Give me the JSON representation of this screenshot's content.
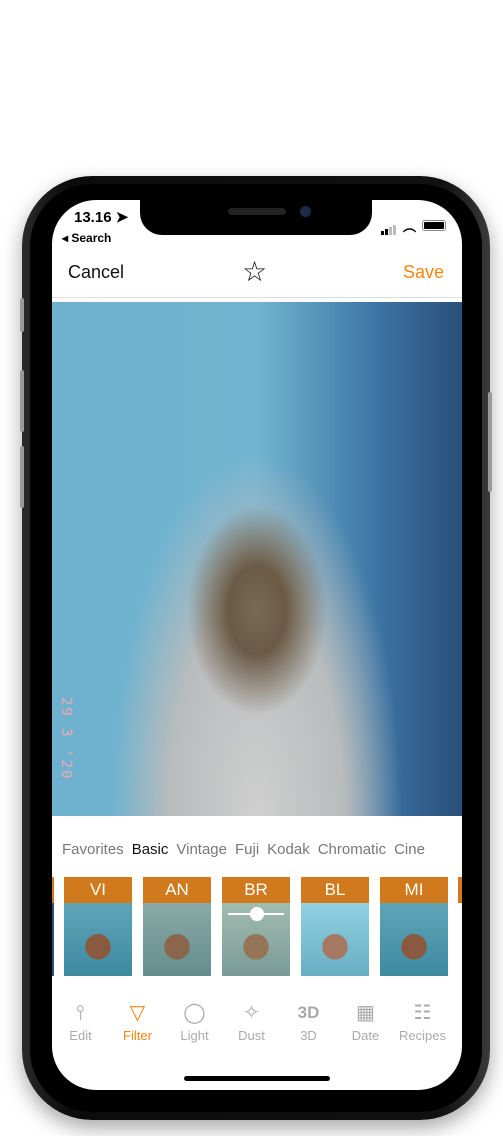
{
  "status": {
    "time": "13.16 ➤",
    "back": "◂ Search"
  },
  "nav": {
    "cancel": "Cancel",
    "save": "Save",
    "favorite_icon": "star-icon"
  },
  "photo": {
    "date_stamp": "29 3 '20"
  },
  "tabs": [
    "Favorites",
    "Basic",
    "Vintage",
    "Fuji",
    "Kodak",
    "Chromatic",
    "Cine"
  ],
  "active_tab": "Basic",
  "filters": [
    {
      "label": "VI"
    },
    {
      "label": "AN"
    },
    {
      "label": "BR",
      "selected": true
    },
    {
      "label": "BL"
    },
    {
      "label": "MI"
    }
  ],
  "tools": [
    {
      "label": "Edit",
      "icon": "⫯"
    },
    {
      "label": "Filter",
      "icon": "▽"
    },
    {
      "label": "Light",
      "icon": "◯"
    },
    {
      "label": "Dust",
      "icon": "✧"
    },
    {
      "label": "3D",
      "icon": "3D"
    },
    {
      "label": "Date",
      "icon": "▦"
    },
    {
      "label": "Recipes",
      "icon": "☷"
    }
  ],
  "colors": {
    "accent": "#f5850f",
    "filter_label": "#d07a1d"
  }
}
